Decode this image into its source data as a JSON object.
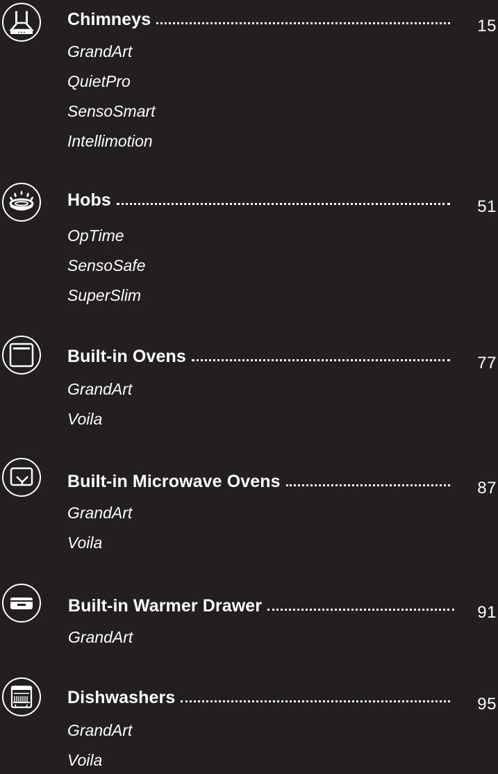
{
  "sections": [
    {
      "title": "Chimneys",
      "page": "15",
      "icon": "chimney-hood-icon",
      "items": [
        "GrandArt",
        "QuietPro",
        "SensoSmart",
        "Intellimotion"
      ]
    },
    {
      "title": "Hobs",
      "page": "51",
      "icon": "gas-burner-icon",
      "items": [
        "OpTime",
        "SensoSafe",
        "SuperSlim"
      ]
    },
    {
      "title": "Built-in Ovens",
      "page": "77",
      "icon": "oven-icon",
      "items": [
        "GrandArt",
        "Voila"
      ]
    },
    {
      "title": "Built-in Microwave Ovens",
      "page": "87",
      "icon": "microwave-icon",
      "items": [
        "GrandArt",
        "Voila"
      ]
    },
    {
      "title": "Built-in Warmer Drawer",
      "page": "91",
      "icon": "warmer-drawer-icon",
      "items": [
        "GrandArt"
      ]
    },
    {
      "title": "Dishwashers",
      "page": "95",
      "icon": "dishwasher-icon",
      "items": [
        "GrandArt",
        "Voila"
      ]
    }
  ],
  "colors": {
    "background": "#231f20",
    "text": "#ffffff"
  }
}
